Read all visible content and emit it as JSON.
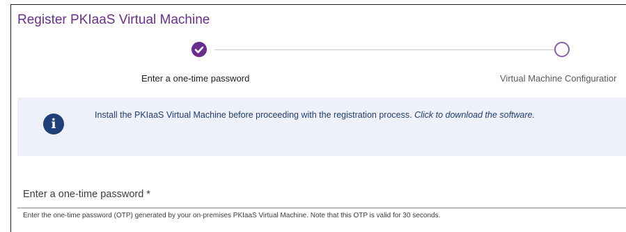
{
  "dialog": {
    "title": "Register PKIaaS Virtual Machine"
  },
  "stepper": {
    "steps": [
      {
        "label": "Enter a one-time password",
        "state": "completed",
        "icon": "check-circle-icon"
      },
      {
        "label": "Virtual Machine Configuratior",
        "state": "pending",
        "icon": "empty-circle-icon"
      }
    ]
  },
  "info_banner": {
    "icon": "info-icon",
    "icon_glyph": "i",
    "message": "Install the PKIaaS Virtual Machine before proceeding with the registration process.",
    "link_text": "Click to download the software."
  },
  "otp_field": {
    "label": "Enter a one-time password *",
    "value": "",
    "help_text": "Enter the one-time password (OTP) generated by your on-premises PKIaaS Virtual Machine. Note that this OTP is valid for 30 seconds."
  },
  "colors": {
    "accent": "#6b2d8e",
    "banner_bg": "#eef1fa",
    "banner_text": "#1f3c73",
    "info_icon_bg": "#1d3f7a"
  }
}
